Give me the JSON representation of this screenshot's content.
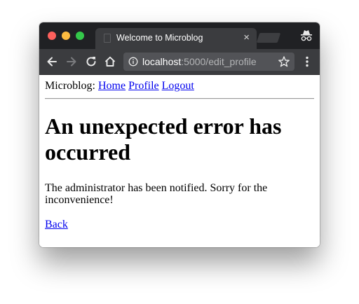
{
  "window": {
    "tab_title": "Welcome to Microblog",
    "tab_close": "×"
  },
  "toolbar": {
    "url_host": "localhost",
    "url_path": ":5000/edit_profile"
  },
  "page": {
    "brand": "Microblog:",
    "nav": [
      {
        "label": "Home"
      },
      {
        "label": "Profile"
      },
      {
        "label": "Logout"
      }
    ],
    "heading": "An unexpected error has occurred",
    "message": "The administrator has been notified. Sorry for the inconvenience!",
    "back_link": "Back"
  },
  "colors": {
    "titlebar": "#202124",
    "toolbar": "#3b3c3f",
    "link": "#0000ee"
  },
  "icons": {
    "back": "back-arrow-icon",
    "forward": "forward-arrow-icon",
    "reload": "reload-icon",
    "home": "home-icon",
    "info": "info-icon",
    "star": "star-icon",
    "menu": "more-vert-icon",
    "incognito": "incognito-icon"
  }
}
